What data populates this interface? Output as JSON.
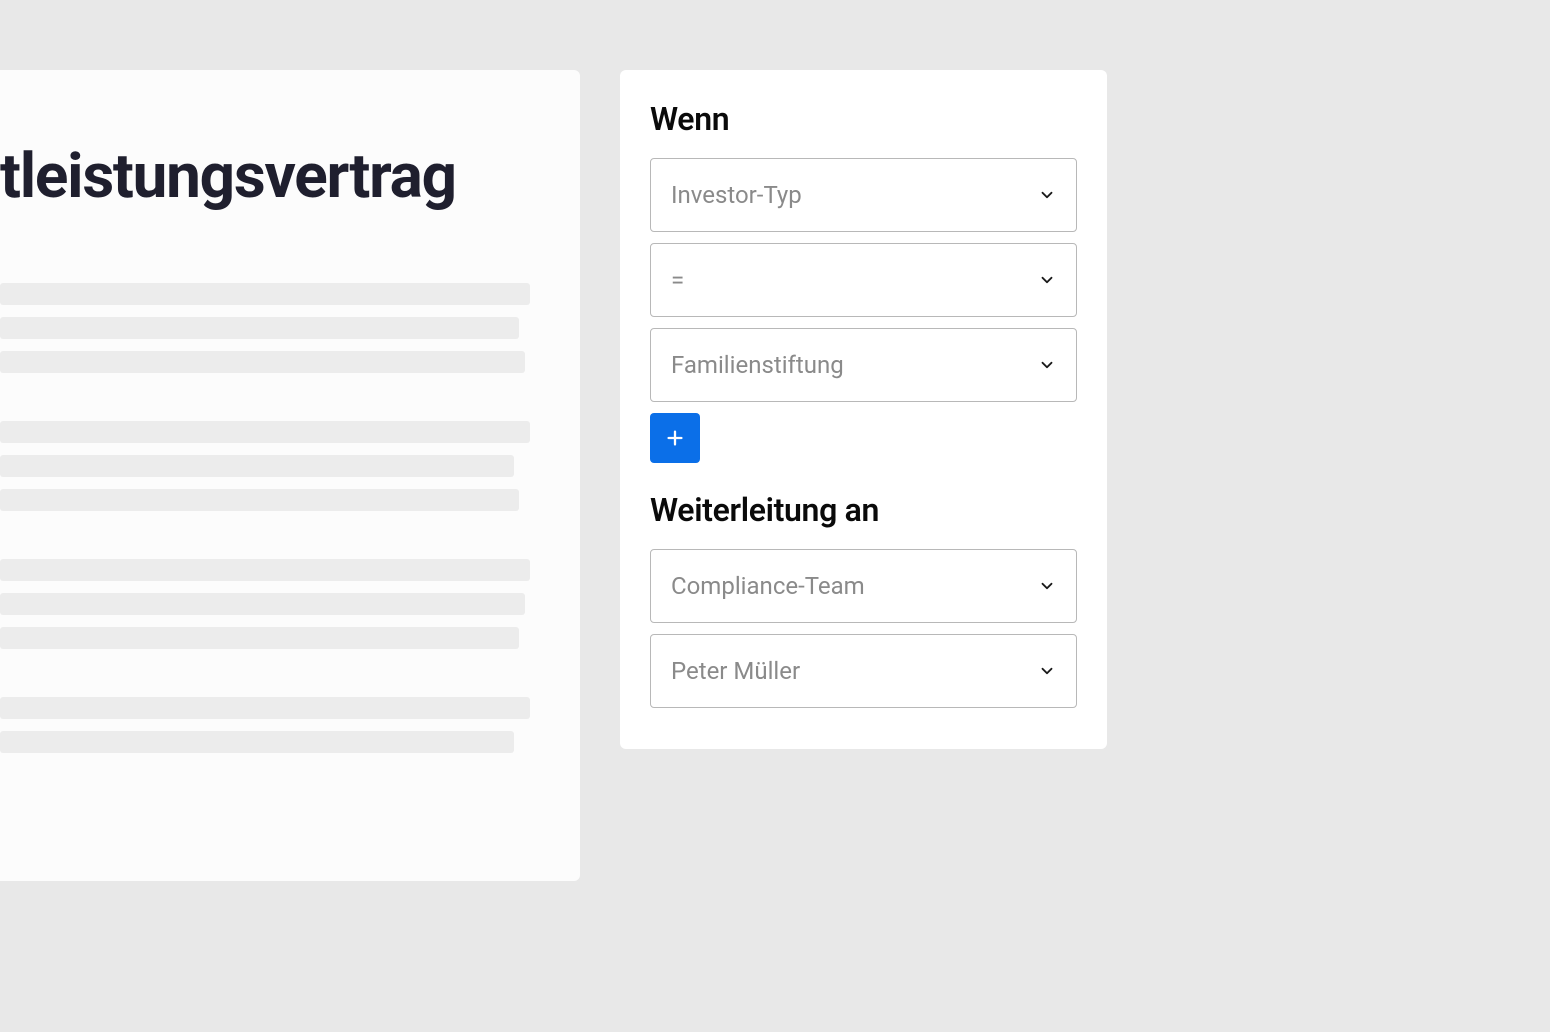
{
  "document": {
    "title": "tleistungsvertrag"
  },
  "rules": {
    "condition_heading": "Wenn",
    "condition": {
      "field": "Investor-Typ",
      "operator": "=",
      "value": "Familienstiftung"
    },
    "routing_heading": "Weiterleitung an",
    "routing": {
      "team": "Compliance-Team",
      "person": "Peter Müller"
    }
  }
}
